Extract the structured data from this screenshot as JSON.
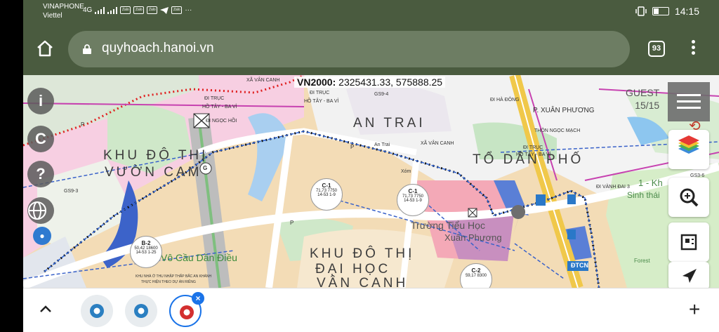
{
  "status_bar": {
    "carrier_1": "VINAPHONE",
    "carrier_2": "Viettel",
    "network": "4G",
    "zalo": "Zalo",
    "more": "···",
    "time": "14:15",
    "battery_level": 0.35
  },
  "browser": {
    "url": "quyhoach.hanoi.vn",
    "tab_count": "93"
  },
  "map": {
    "coordinates_label": "VN2000:",
    "coordinates_value": "2325431.33, 575888.25",
    "user": "GUEST",
    "layer_count": "15/15",
    "labels": {
      "xa_van_canh_top": "XÃ VÂN CANH",
      "di_truc_1": "ĐI TRỤC",
      "ho_tay_ba_vi_1": "HỒ TÂY - BA VÌ",
      "di_ngoc_hoi": "ĐI NGỌC HỒI",
      "di_truc_2": "ĐI TRỤC",
      "ho_tay_ba_vi_2": "HỒ TÂY - BA VÌ",
      "an_trai": "AN TRAI",
      "xa_van_canh_mid": "XÃ VÂN CANH",
      "p_xuan_phuong": "P. XUÂN PHƯƠNG",
      "di_ha_dong": "ĐI HÀ ĐÔNG",
      "thon_ngoc_mach": "THÔN NGỌC MẠCH",
      "di_truc_3": "ĐI TRỤC",
      "ho_tay_ba_vi_3": "HỒ TÂY - BA VÌ",
      "to_dan_pho": "TỔ DÂN PHỐ",
      "di_vanh_dai": "ĐI VÀNH ĐAI 3",
      "khu_do_thi_1": "KHU ĐÔ THỊ",
      "vuon_cam": "VƯỜN CAM",
      "khu_do_thi_2": "KHU ĐÔ THỊ",
      "dai_hoc": "ĐẠI HỌC",
      "van_canh": "VÂN CANH",
      "truong": "Trường Tiểu Học",
      "xuan_phuong": "Xuân Phương",
      "cau_dan_dieu": "Vô Cầu Dần Điều",
      "xom": "Xóm",
      "an_trai_small": "An Trai",
      "gs9_4": "GS9-4",
      "gs9_3": "GS9-3",
      "gs3_6": "GS3-6",
      "khu_nha_o": "KHU NHÀ Ở THU NHẬP THẤP BẮC AN KHÁNH",
      "thuc_hien": "THỰC HIỆN THEO DỰ ÁN RIÊNG",
      "dtcn": "ĐTCN",
      "forest": "Forest",
      "vanh_dai_fragment": "1 - Kh",
      "sinh_thai_fragment": "Sinh thái"
    },
    "lots": [
      {
        "code": "C-1",
        "a": "71,73",
        "b": "7750",
        "c": "14-53",
        "d": "1-9"
      },
      {
        "code": "C-1",
        "a": "71,73",
        "b": "7750",
        "c": "14-53",
        "d": "1-9"
      },
      {
        "code": "B-2",
        "a": "50,42",
        "b": "18600",
        "c": "14-53",
        "d": "1-25"
      },
      {
        "code": "C-2",
        "a": "59,17",
        "b": "8300",
        "c": "",
        "d": ""
      }
    ],
    "markers": {
      "g": "G",
      "p": "P"
    }
  },
  "bottom_bar": {
    "add": "+",
    "close": "×"
  },
  "colors": {
    "chrome": "#4a5b3f",
    "url_box": "#6d7d63",
    "accent": "#1a73e8"
  }
}
